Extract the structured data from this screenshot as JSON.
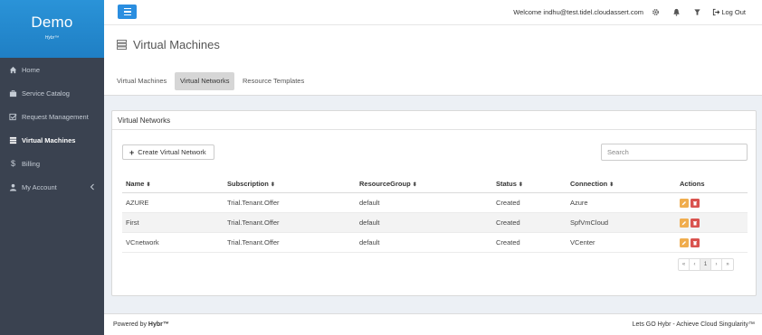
{
  "brand": {
    "title": "Demo",
    "subtitle": "Hybr™"
  },
  "sidebar": {
    "items": [
      {
        "label": "Home",
        "icon": "home-icon"
      },
      {
        "label": "Service Catalog",
        "icon": "briefcase-icon"
      },
      {
        "label": "Request Management",
        "icon": "checkbox-icon"
      },
      {
        "label": "Virtual Machines",
        "icon": "server-icon",
        "active": true
      },
      {
        "label": "Billing",
        "icon": "dollar-icon"
      },
      {
        "label": "My Account",
        "icon": "user-icon"
      }
    ]
  },
  "topbar": {
    "welcome_prefix": "Welcome ",
    "user_email": "indhu@test.tidel.cloudassert.com",
    "logout_label": "Log Out",
    "icons": [
      "menu-icon",
      "gear-icon",
      "bell-icon",
      "filter-icon",
      "logout-icon"
    ]
  },
  "page": {
    "title": "Virtual Machines"
  },
  "tabs": [
    {
      "label": "Virtual Machines"
    },
    {
      "label": "Virtual Networks",
      "active": true
    },
    {
      "label": "Resource Templates"
    }
  ],
  "panel": {
    "heading": "Virtual Networks",
    "create_label": "Create Virtual Network",
    "search_placeholder": "Search"
  },
  "table": {
    "headers": [
      "Name",
      "Subscription",
      "ResourceGroup",
      "Status",
      "Connection",
      "Actions"
    ],
    "rows": [
      [
        "AZURE",
        "Trial.Tenant.Offer",
        "default",
        "Created",
        "Azure"
      ],
      [
        "First",
        "Trial.Tenant.Offer",
        "default",
        "Created",
        "SpfVmCloud"
      ],
      [
        "VCnetwork",
        "Trial.Tenant.Offer",
        "default",
        "Created",
        "VCenter"
      ]
    ]
  },
  "pagination": {
    "first": "«",
    "prev": "‹",
    "current": "1",
    "next": "›",
    "last": "»"
  },
  "footer": {
    "powered_prefix": "Powered by ",
    "powered_brand": "Hybr™",
    "tagline": "Lets GO Hybr - Achieve Cloud Singularity™"
  },
  "colors": {
    "sidebar_bg": "#3a4250",
    "brand_blue": "#2a8ee0",
    "edit_orange": "#f0ad4e",
    "delete_red": "#d9534f"
  }
}
